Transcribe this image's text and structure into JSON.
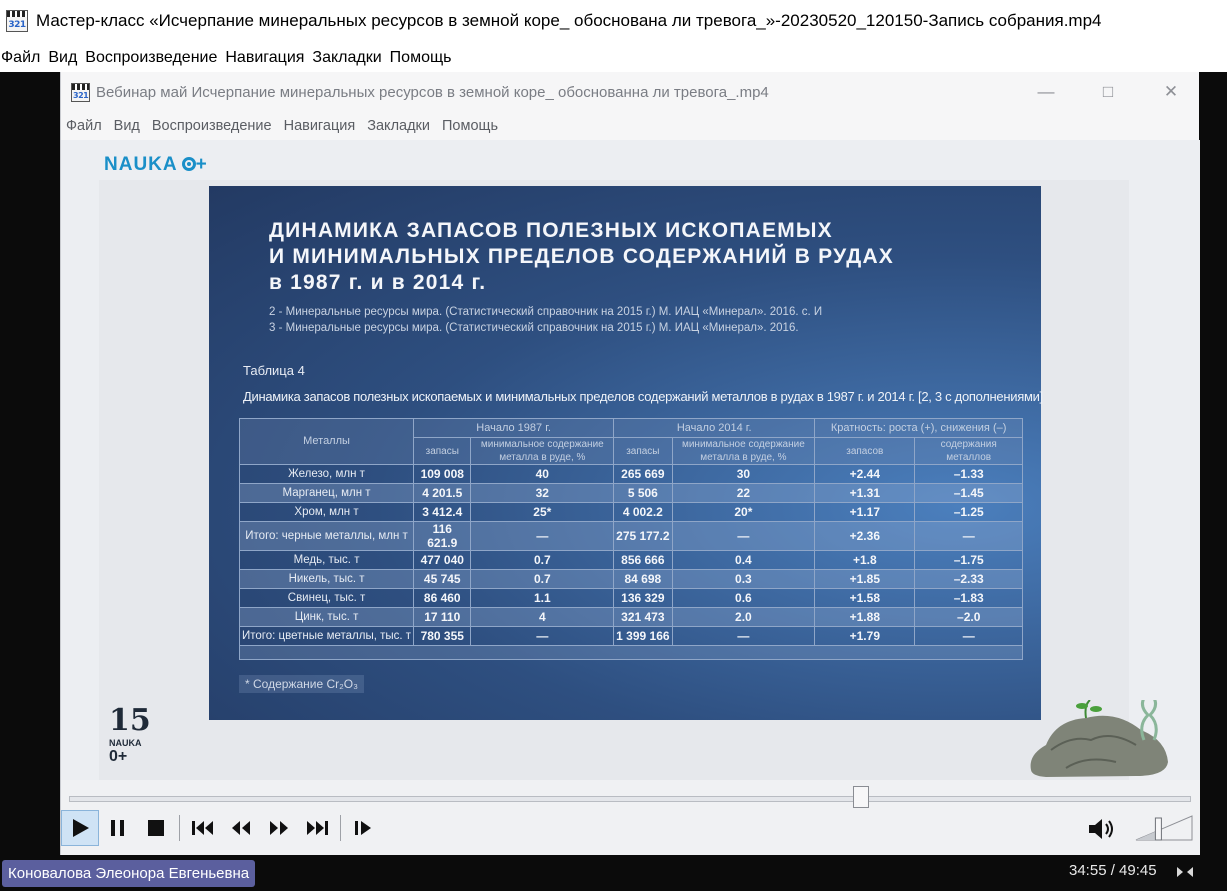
{
  "outer": {
    "title": "Мастер-класс «Исчерпание минеральных ресурсов в земной коре_ обоснована ли тревога_»-20230520_120150-Запись собрания.mp4",
    "icon_text": "321",
    "menu": [
      "Файл",
      "Вид",
      "Воспроизведение",
      "Навигация",
      "Закладки",
      "Помощь"
    ]
  },
  "inner": {
    "title": "Вебинар май Исчерпание минеральных ресурсов в земной коре_ обоснованна ли тревога_.mp4",
    "icon_text": "321",
    "menu": [
      "Файл",
      "Вид",
      "Воспроизведение",
      "Навигация",
      "Закладки",
      "Помощь"
    ]
  },
  "video": {
    "logo": "NAUKA",
    "logo_plus": "+",
    "slide": {
      "title_line1": "ДИНАМИКА ЗАПАСОВ ПОЛЕЗНЫХ ИСКОПАЕМЫХ",
      "title_line2": "И МИНИМАЛЬНЫХ ПРЕДЕЛОВ СОДЕРЖАНИЙ В РУДАХ",
      "title_line3": "в 1987 г. и в 2014 г.",
      "ref1": "2 - Минеральные ресурсы мира. (Статистический справочник на 2015 г.) М. ИАЦ «Минерал». 2016. с. И",
      "ref2": "3 - Минеральные ресурсы мира. (Статистический справочник на 2015 г.) М. ИАЦ «Минерал». 2016.",
      "table_caption": "Таблица 4",
      "table_subtitle": "Динамика запасов полезных ископаемых и минимальных пределов содержаний металлов в рудах в 1987 г. и 2014 г. [2, 3 с дополнениями]",
      "headers": {
        "metals": "Металлы",
        "start1987": "Начало 1987 г.",
        "start2014": "Начало 2014 г.",
        "ratio": "Кратность: роста (+), снижения (–)",
        "reserves": "запасы",
        "min_content": "минимальное содержание металла в руде, %",
        "ratio_reserves": "запасов",
        "ratio_content": "содержания металлов"
      },
      "rows": [
        {
          "name": "Железо, млн т",
          "r1987": "109 008",
          "c1987": "40",
          "r2014": "265 669",
          "c2014": "30",
          "kr": "+2.44",
          "kc": "–1.33"
        },
        {
          "name": "Марганец, млн т",
          "r1987": "4 201.5",
          "c1987": "32",
          "r2014": "5 506",
          "c2014": "22",
          "kr": "+1.31",
          "kc": "–1.45"
        },
        {
          "name": "Хром, млн т",
          "r1987": "3 412.4",
          "c1987": "25*",
          "r2014": "4 002.2",
          "c2014": "20*",
          "kr": "+1.17",
          "kc": "–1.25"
        },
        {
          "name": "Итого: черные металлы, млн т",
          "r1987": "116 621.9",
          "c1987": "—",
          "r2014": "275 177.2",
          "c2014": "—",
          "kr": "+2.36",
          "kc": "—"
        },
        {
          "name": "Медь, тыс. т",
          "r1987": "477 040",
          "c1987": "0.7",
          "r2014": "856 666",
          "c2014": "0.4",
          "kr": "+1.8",
          "kc": "–1.75"
        },
        {
          "name": "Никель, тыс. т",
          "r1987": "45 745",
          "c1987": "0.7",
          "r2014": "84 698",
          "c2014": "0.3",
          "kr": "+1.85",
          "kc": "–2.33"
        },
        {
          "name": "Свинец, тыс. т",
          "r1987": "86 460",
          "c1987": "1.1",
          "r2014": "136 329",
          "c2014": "0.6",
          "kr": "+1.58",
          "kc": "–1.83"
        },
        {
          "name": "Цинк, тыс. т",
          "r1987": "17 110",
          "c1987": "4",
          "r2014": "321 473",
          "c2014": "2.0",
          "kr": "+1.88",
          "kc": "–2.0"
        },
        {
          "name": "Итого: цветные металлы, тыс. т",
          "r1987": "780 355",
          "c1987": "—",
          "r2014": "1 399 166",
          "c2014": "—",
          "kr": "+1.79",
          "kc": "—"
        }
      ],
      "footnote": "* Содержание Cr₂O₃"
    },
    "anniversary": {
      "number": "15",
      "label": "NAUKA",
      "mark": "0+"
    }
  },
  "player": {
    "progress": 0.7061,
    "volume_level": 0.4,
    "colors": {
      "active_button": "#cfe3f5",
      "presenter_badge": "#5b5f9e"
    }
  },
  "meeting": {
    "presenter": "Коновалова Элеонора Евгеньевна",
    "timecode": "34:55 / 49:45"
  }
}
